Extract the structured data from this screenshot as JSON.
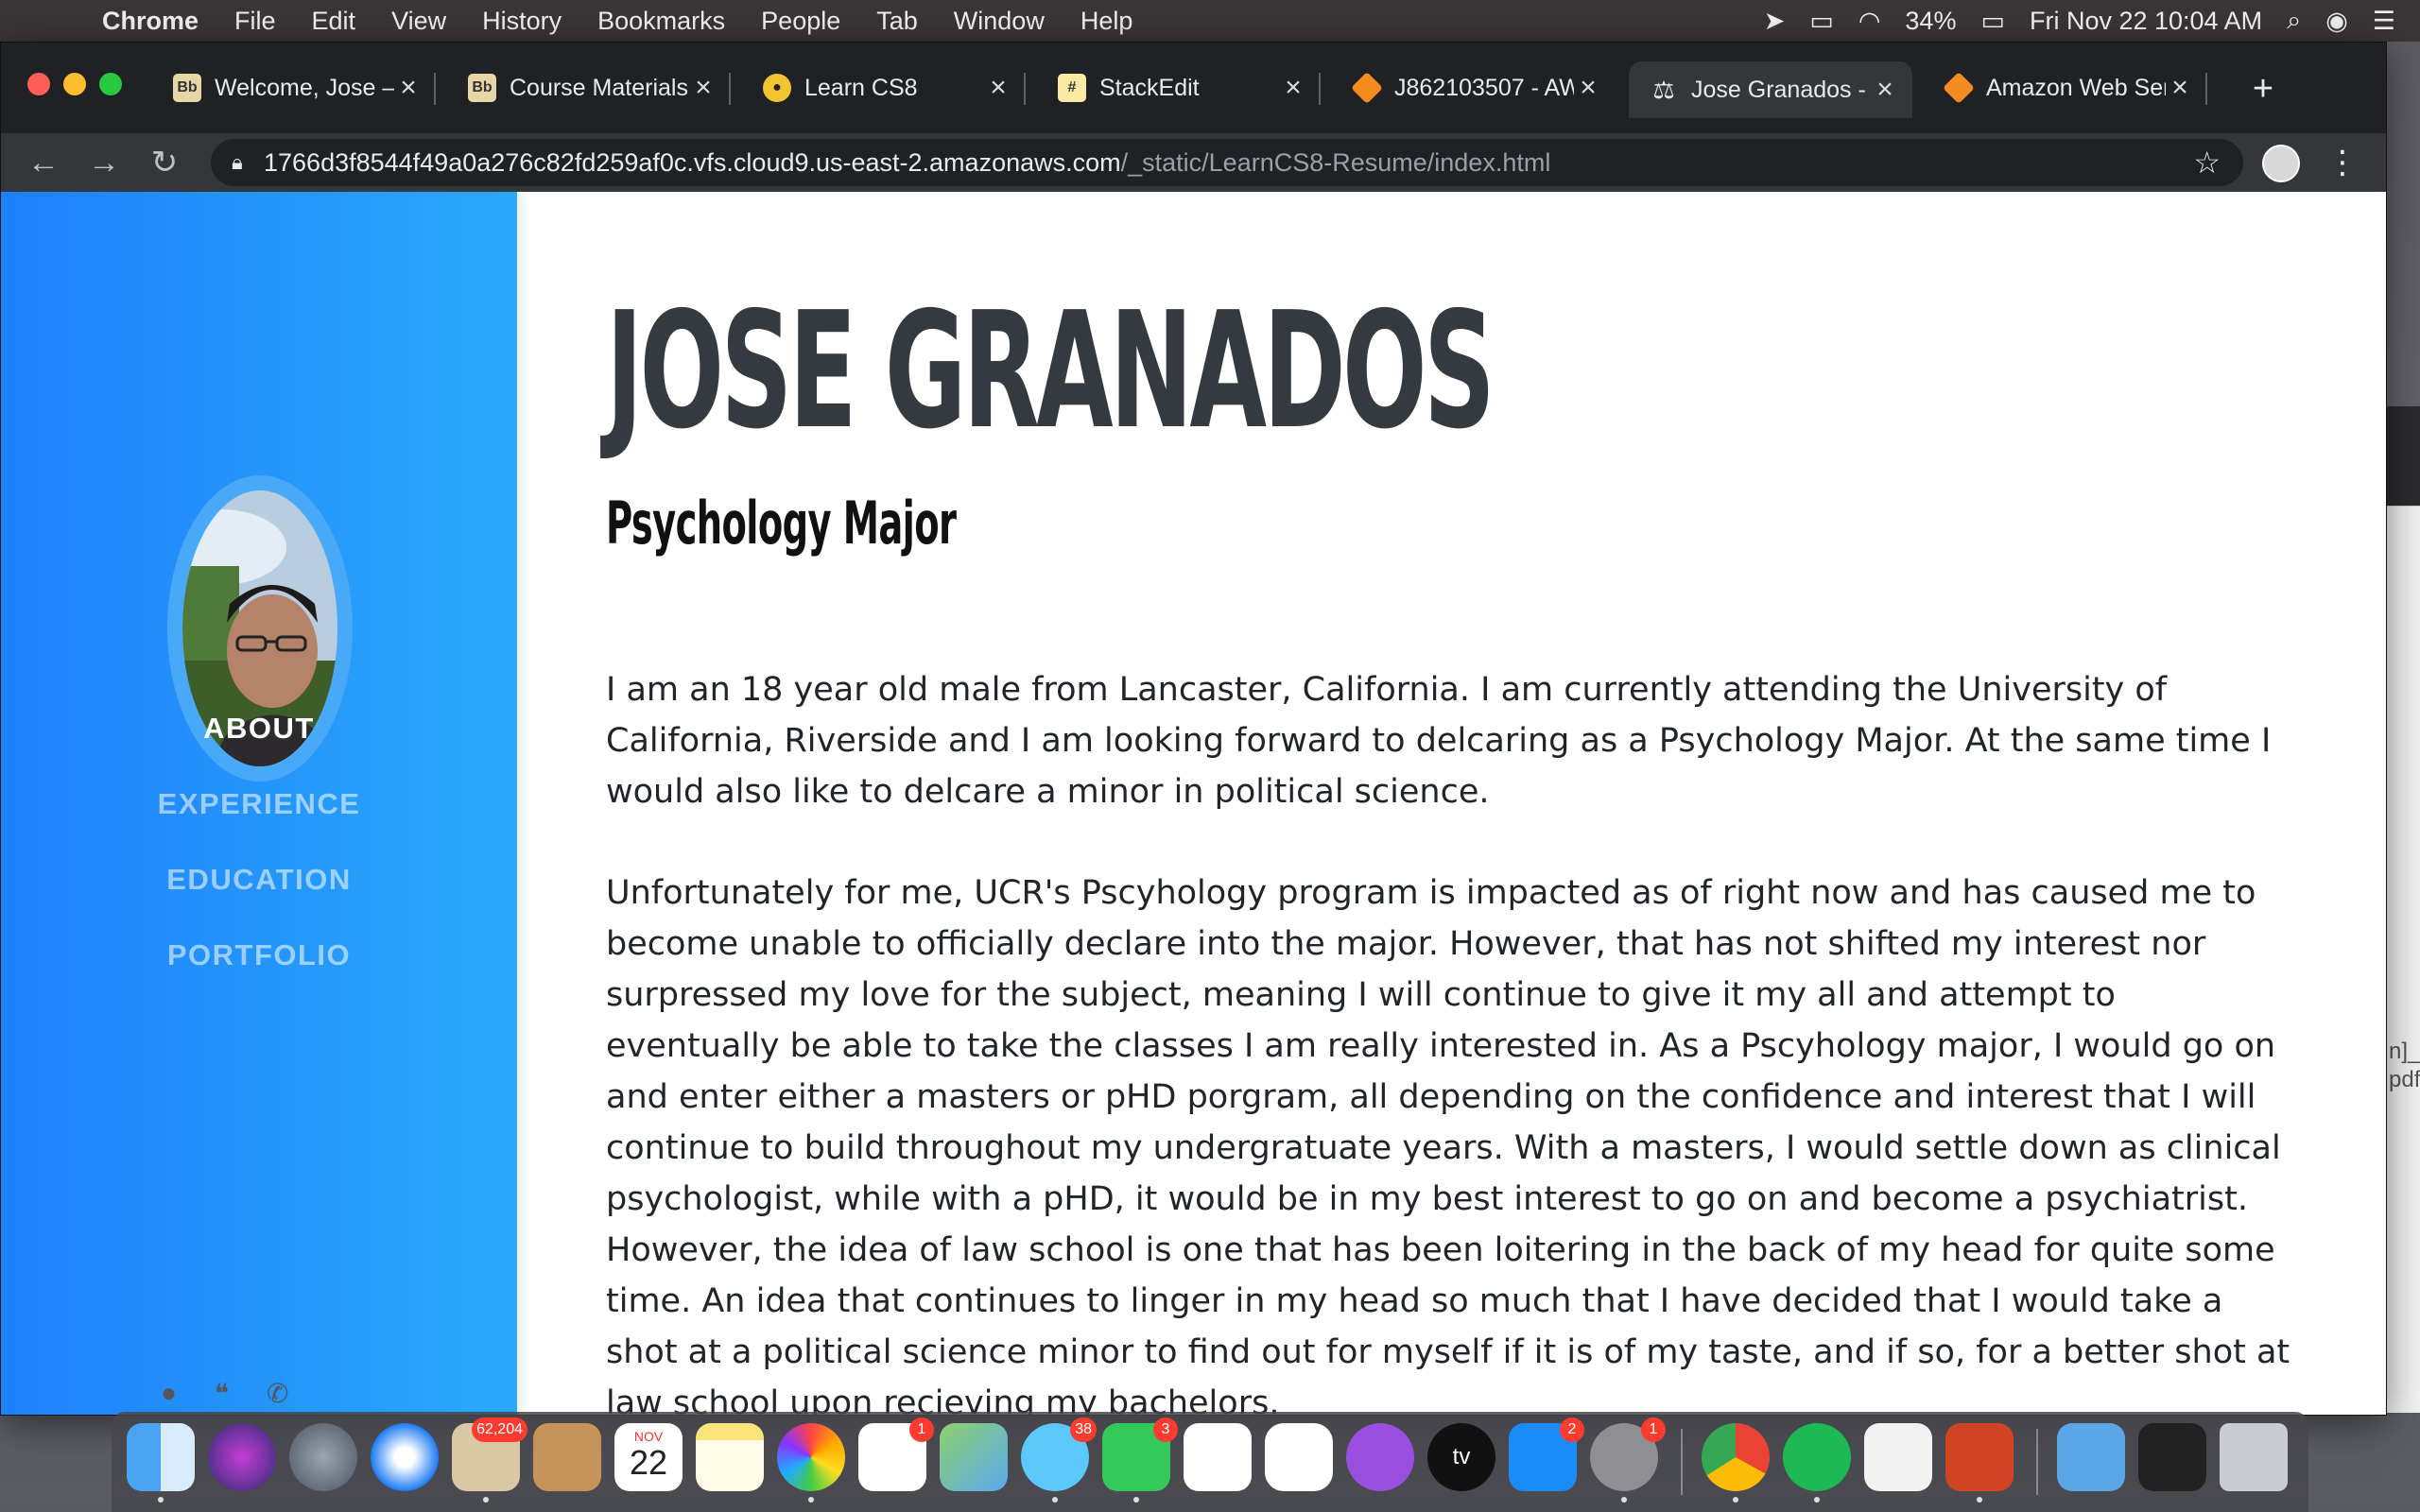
{
  "menubar": {
    "app_name": "Chrome",
    "menus": [
      "File",
      "Edit",
      "View",
      "History",
      "Bookmarks",
      "People",
      "Tab",
      "Window",
      "Help"
    ],
    "battery": "34%",
    "datetime": "Fri Nov 22  10:04 AM"
  },
  "tabs": [
    {
      "title": "Welcome, Jose –",
      "favicon": "Bb"
    },
    {
      "title": "Course Materials",
      "favicon": "Bb"
    },
    {
      "title": "Learn CS8",
      "favicon": "cat-icon"
    },
    {
      "title": "StackEdit",
      "favicon": "#"
    },
    {
      "title": "J862103507 - AW",
      "favicon": "aws-cube-icon"
    },
    {
      "title": "Jose Granados -",
      "favicon": "scale-icon"
    },
    {
      "title": "Amazon Web Ser",
      "favicon": "aws-cube-icon"
    }
  ],
  "address_bar": {
    "host": "1766d3f8544f49a0a276c82fd259af0c.vfs.cloud9.us-east-2.amazonaws.com",
    "path": "/_static/LearnCS8-Resume/index.html"
  },
  "sidebar": {
    "nav": [
      "ABOUT",
      "EXPERIENCE",
      "EDUCATION",
      "PORTFOLIO"
    ]
  },
  "content": {
    "name": "JOSE GRANADOS",
    "subtitle": "Psychology Major",
    "paragraph1": "I am an 18 year old male from Lancaster, California. I am currently attending the University of California, Riverside and I am looking forward to delcaring as a Psychology Major. At the same time I would also like to delcare a minor in political science.",
    "paragraph2": "Unfortunately for me, UCR's Pscyhology program is impacted as of right now and has caused me to become unable to officially declare into the major. However, that has not shifted my interest nor surpressed my love for the subject, meaning I will continue to give it my all and attempt to eventually be able to take the classes I am really interested in. As a Pscyhology major, I would go on and enter either a masters or pHD porgram, all depending on the confidence and interest that I will continue to build throughout my undergratuate years. With a masters, I would settle down as clinical psychologist, while with a pHD, it would be in my best interest to go on and become a psychiatrist. However, the idea of law school is one that has been loitering in the back of my head for quite some time. An idea that continues to linger in my head so much that I have decided that I would take a shot at a political science minor to find out for myself if it is of my taste, and if so, for a better shot at law school upon recieving my bachelors."
  },
  "background_window_text": [
    "n]_",
    "pdf"
  ],
  "dock": {
    "badges": {
      "mail": "62,204",
      "reminders": "1",
      "messages": "38",
      "facetime": "3",
      "app_store": "2",
      "system_prefs": "1"
    },
    "calendar_month": "NOV",
    "calendar_day": "22",
    "tv_label": "tv"
  },
  "colors": {
    "sidebar_start": "#1e80fb",
    "sidebar_end": "#2aa9fb",
    "heading": "#343a40"
  }
}
